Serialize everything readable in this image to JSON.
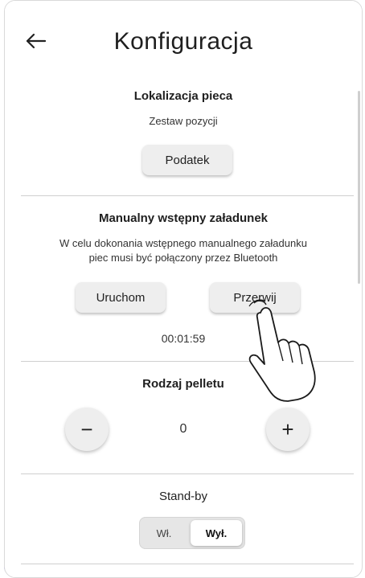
{
  "header": {
    "title": "Konfiguracja"
  },
  "furnace_location": {
    "title": "Lokalizacja pieca",
    "subtitle": "Zestaw pozycji",
    "button_label": "Podatek"
  },
  "manual_loading": {
    "title": "Manualny wstępny załadunek",
    "description_line1": "W celu dokonania wstępnego manualnego załadunku",
    "description_line2": "piec musi być połączony przez Bluetooth",
    "start_label": "Uruchom",
    "stop_label": "Przerwij",
    "timer": "00:01:59"
  },
  "pellet_type": {
    "title": "Rodzaj pelletu",
    "value": "0",
    "decrement_symbol": "−",
    "increment_symbol": "+"
  },
  "standby": {
    "title": "Stand-by",
    "on_label": "Wł.",
    "off_label": "Wył.",
    "selected": "Wył."
  },
  "icons": {
    "back": "arrow-left-icon",
    "gesture": "hand-pointer-icon"
  },
  "colors": {
    "button_bg": "#eeeeee",
    "accent_bottom": "#7b74e6"
  }
}
